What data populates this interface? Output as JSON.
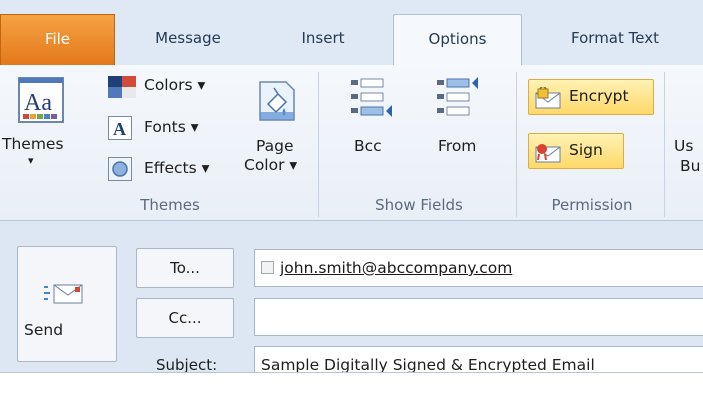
{
  "tabs": [
    {
      "label": "File"
    },
    {
      "label": "Message"
    },
    {
      "label": "Insert"
    },
    {
      "label": "Options"
    },
    {
      "label": "Format Text"
    }
  ],
  "ribbon": {
    "themes_group": {
      "themes_label_1": "Themes",
      "themes_label_2": "▾",
      "colors": "Colors ▾",
      "fonts": "Fonts ▾",
      "effects": "Effects ▾",
      "page_color_1": "Page",
      "page_color_2": "Color ▾",
      "group_label": "Themes"
    },
    "show_fields_group": {
      "bcc": "Bcc",
      "from": "From",
      "group_label": "Show Fields"
    },
    "permission_group": {
      "encrypt": "Encrypt",
      "sign": "Sign",
      "group_label": "Permission"
    },
    "cut_off": {
      "line1": "Us",
      "line2": "Bu"
    }
  },
  "compose": {
    "send": "Send",
    "to_button": "To...",
    "cc_button": "Cc...",
    "subject_label": "Subject:",
    "to_value": "john.smith@abccompany.com",
    "cc_value": "",
    "subject_value": "Sample Digitally Signed  & Encrypted Email"
  },
  "colors": {
    "file_tab": "#e8811f",
    "button_highlight": "#ffd86a",
    "ribbon_bg": "#f5f8fc",
    "compose_bg": "#dde7f3"
  }
}
